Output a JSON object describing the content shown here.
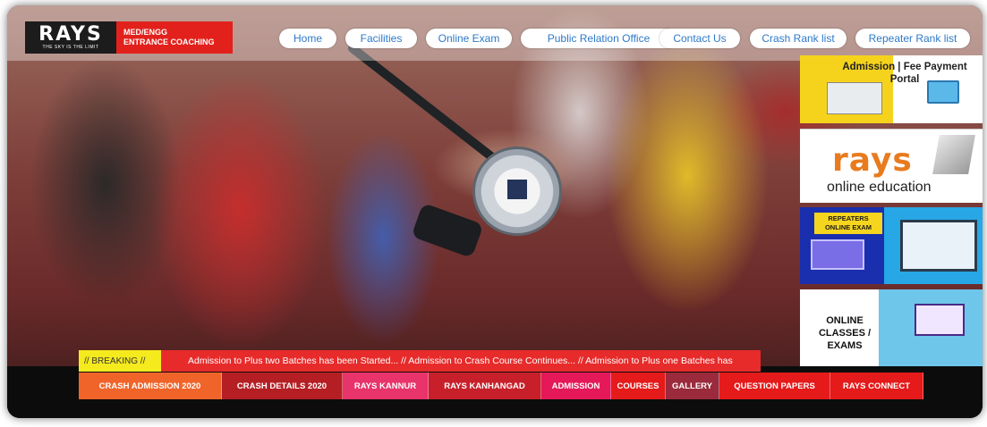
{
  "brand": {
    "name": "RAYS",
    "tagline": "THE SKY IS THE LIMIT",
    "subtitle_line1": "MED/ENGG",
    "subtitle_line2": "ENTRANCE COACHING"
  },
  "nav": {
    "items": [
      {
        "label": "Home"
      },
      {
        "label": "Facilities"
      },
      {
        "label": "Online Exam"
      },
      {
        "label": "Public Relation Office"
      },
      {
        "label": "Contact Us"
      },
      {
        "label": "Crash Rank list"
      },
      {
        "label": "Repeater Rank list"
      }
    ]
  },
  "sidebar": {
    "admission_title": "Admission | Fee Payment Portal",
    "rays_word": "rays",
    "rays_sub": "online education",
    "repeaters_line1": "REPEATERS",
    "repeaters_line2": "ONLINE EXAM",
    "online_title": "ONLINE CLASSES / EXAMS"
  },
  "breaking": {
    "tag": "// BREAKING //",
    "message": "Admission to Plus two Batches has been Started...  //  Admission to Crash Course Continues...  // Admission to Plus one Batches has"
  },
  "menu": {
    "items": [
      {
        "label": "CRASH ADMISSION 2020",
        "color": "#f0642a"
      },
      {
        "label": "CRASH DETAILS 2020",
        "color": "#b51f24"
      },
      {
        "label": "RAYS KANNUR",
        "color": "#e8336b"
      },
      {
        "label": "RAYS KANHANGAD",
        "color": "#c8202a"
      },
      {
        "label": "ADMISSION",
        "color": "#e5185a"
      },
      {
        "label": "COURSES",
        "color": "#e51a1a"
      },
      {
        "label": "GALLERY",
        "color": "#9a2a3c"
      },
      {
        "label": "QUESTION PAPERS",
        "color": "#e51a1a"
      },
      {
        "label": "RAYS CONNECT",
        "color": "#e51a1a"
      }
    ]
  }
}
